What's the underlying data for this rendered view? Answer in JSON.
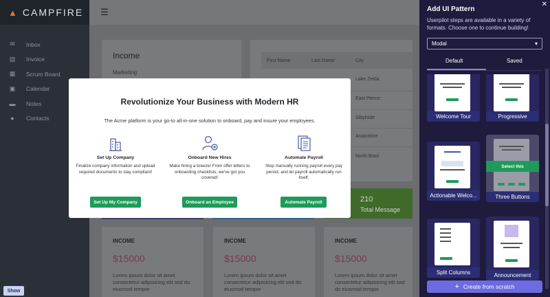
{
  "app": {
    "brand": "CAMPFIRE"
  },
  "sidebar": {
    "items": [
      {
        "label": "Inbox",
        "icon": "mail-icon"
      },
      {
        "label": "Invoice",
        "icon": "invoice-icon"
      },
      {
        "label": "Scrum Board",
        "icon": "board-icon"
      },
      {
        "label": "Calendar",
        "icon": "calendar-icon"
      },
      {
        "label": "Notes",
        "icon": "notes-icon"
      },
      {
        "label": "Contacts",
        "icon": "contacts-icon"
      }
    ],
    "show_label": "Show"
  },
  "dashboard": {
    "income_card": {
      "title": "Income",
      "subtitle": "Marketing"
    },
    "table": {
      "headers": [
        "First Name",
        "Last Name",
        "City"
      ],
      "cities": [
        "Lake Zelda",
        "East Pierce",
        "Sibylside",
        "Anaisshire",
        "North Brad"
      ]
    },
    "stat": {
      "value": "210",
      "label": "Total Message"
    },
    "income_boxes": [
      {
        "title": "INCOME",
        "value": "$15000",
        "desc": "Lorem ipsum dolor sit amet consectetur adipisicing elit sed do eiusmod tempor"
      },
      {
        "title": "INCOME",
        "value": "$15000",
        "desc": "Lorem ipsum dolor sit amet consectetur adipisicing elit sed do eiusmod tempor"
      },
      {
        "title": "INCOME",
        "value": "$15000",
        "desc": "Lorem ipsum dolor sit amet consectetur adipisicing elit sed do eiusmod tempor"
      }
    ]
  },
  "modal": {
    "title": "Revolutionize Your Business with Modern HR",
    "lead": "The Acme platform is your go-to all-in-one solution to onboard, pay and insure your employees.",
    "columns": [
      {
        "title": "Set Up Company",
        "desc": "Finalize company information and upload required documents to stay compliant!",
        "cta": "Set Up My Company",
        "icon": "building-icon"
      },
      {
        "title": "Onboard New Hires",
        "desc": "Make hiring a breeze! From offer letters to onboarding checklists, we've got you covered!",
        "cta": "Onboard an Employee",
        "icon": "add-person-icon"
      },
      {
        "title": "Automate Payroll",
        "desc": "Stop manually running payroll every pay period, and let payroll automatically run itself.",
        "cta": "Automate Payroll",
        "icon": "documents-icon"
      }
    ]
  },
  "panel": {
    "title": "Add UI Pattern",
    "description": "Userpilot steps are available in a variety of formats. Choose one to continue building!",
    "select_value": "Modal",
    "tabs": [
      "Default",
      "Saved"
    ],
    "tiles": [
      "Welcome Tour",
      "Progressive",
      "Actionable Welco...",
      "Three Buttons",
      "Split Columns",
      "Announcement"
    ],
    "hover_label": "Select this",
    "create_label": "Create from scratch",
    "colors": {
      "accent": "#6e6be0",
      "panel_bg": "#1e1b3d",
      "cta_green": "#1e9b5a"
    }
  }
}
